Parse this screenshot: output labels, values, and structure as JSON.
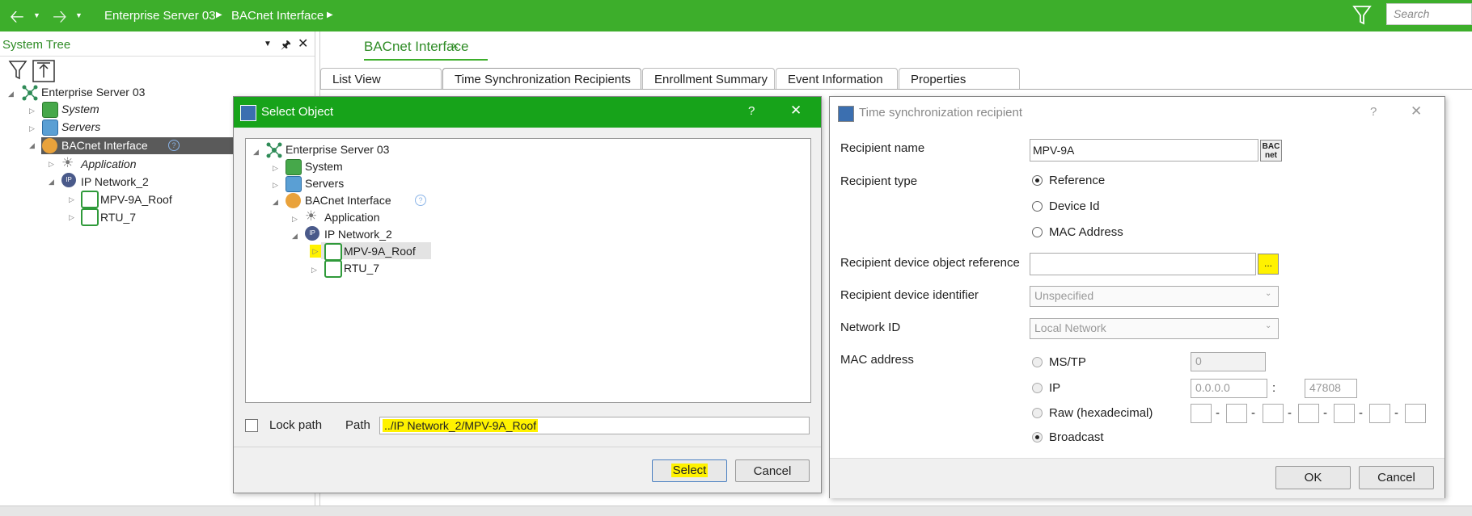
{
  "topbar": {
    "crumb1": "Enterprise Server 03",
    "crumb2": "BACnet Interface",
    "search_placeholder": "Search"
  },
  "system_tree": {
    "title": "System Tree",
    "items": [
      {
        "label": "Enterprise Server 03"
      },
      {
        "label": "System"
      },
      {
        "label": "Servers"
      },
      {
        "label": "BACnet Interface"
      },
      {
        "label": "Application"
      },
      {
        "label": "IP Network_2"
      },
      {
        "label": "MPV-9A_Roof"
      },
      {
        "label": "RTU_7"
      }
    ]
  },
  "workspace": {
    "title": "BACnet Interface",
    "close": "×",
    "tabs": [
      "List View",
      "Time Synchronization Recipients",
      "Enrollment Summary",
      "Event Information",
      "Properties"
    ]
  },
  "select_object": {
    "title": "Select Object",
    "help": "?",
    "tree": [
      {
        "label": "Enterprise Server 03"
      },
      {
        "label": "System"
      },
      {
        "label": "Servers"
      },
      {
        "label": "BACnet Interface"
      },
      {
        "label": "Application"
      },
      {
        "label": "IP Network_2"
      },
      {
        "label": "MPV-9A_Roof"
      },
      {
        "label": "RTU_7"
      }
    ],
    "lock_path_label": "Lock path",
    "path_label": "Path",
    "path_value": "../IP Network_2/MPV-9A_Roof",
    "select_label": "Select",
    "cancel_label": "Cancel"
  },
  "time_sync": {
    "title": "Time synchronization recipient",
    "help": "?",
    "recipient_name_label": "Recipient name",
    "recipient_name_value": "MPV-9A",
    "bacnet_badge": "BAC net",
    "recipient_type_label": "Recipient type",
    "type_options": [
      "Reference",
      "Device Id",
      "MAC Address"
    ],
    "device_ref_label": "Recipient device object reference",
    "browse_label": "...",
    "device_id_label": "Recipient device identifier",
    "device_id_value": "Unspecified",
    "network_id_label": "Network ID",
    "network_id_value": "Local Network",
    "mac_label": "MAC address",
    "mac_options": [
      "MS/TP",
      "IP",
      "Raw (hexadecimal)",
      "Broadcast"
    ],
    "mstp_value": "0",
    "ip_value": "0.0.0.0",
    "ip_colon": ":",
    "port_value": "47808",
    "raw_sep": "-",
    "ok_label": "OK",
    "cancel_label": "Cancel"
  },
  "colors": {
    "brand_green": "#3dae2b",
    "dialog_title_green": "#17a31a",
    "highlight_yellow": "#fff200",
    "selection_dark": "#5a5a5a"
  }
}
